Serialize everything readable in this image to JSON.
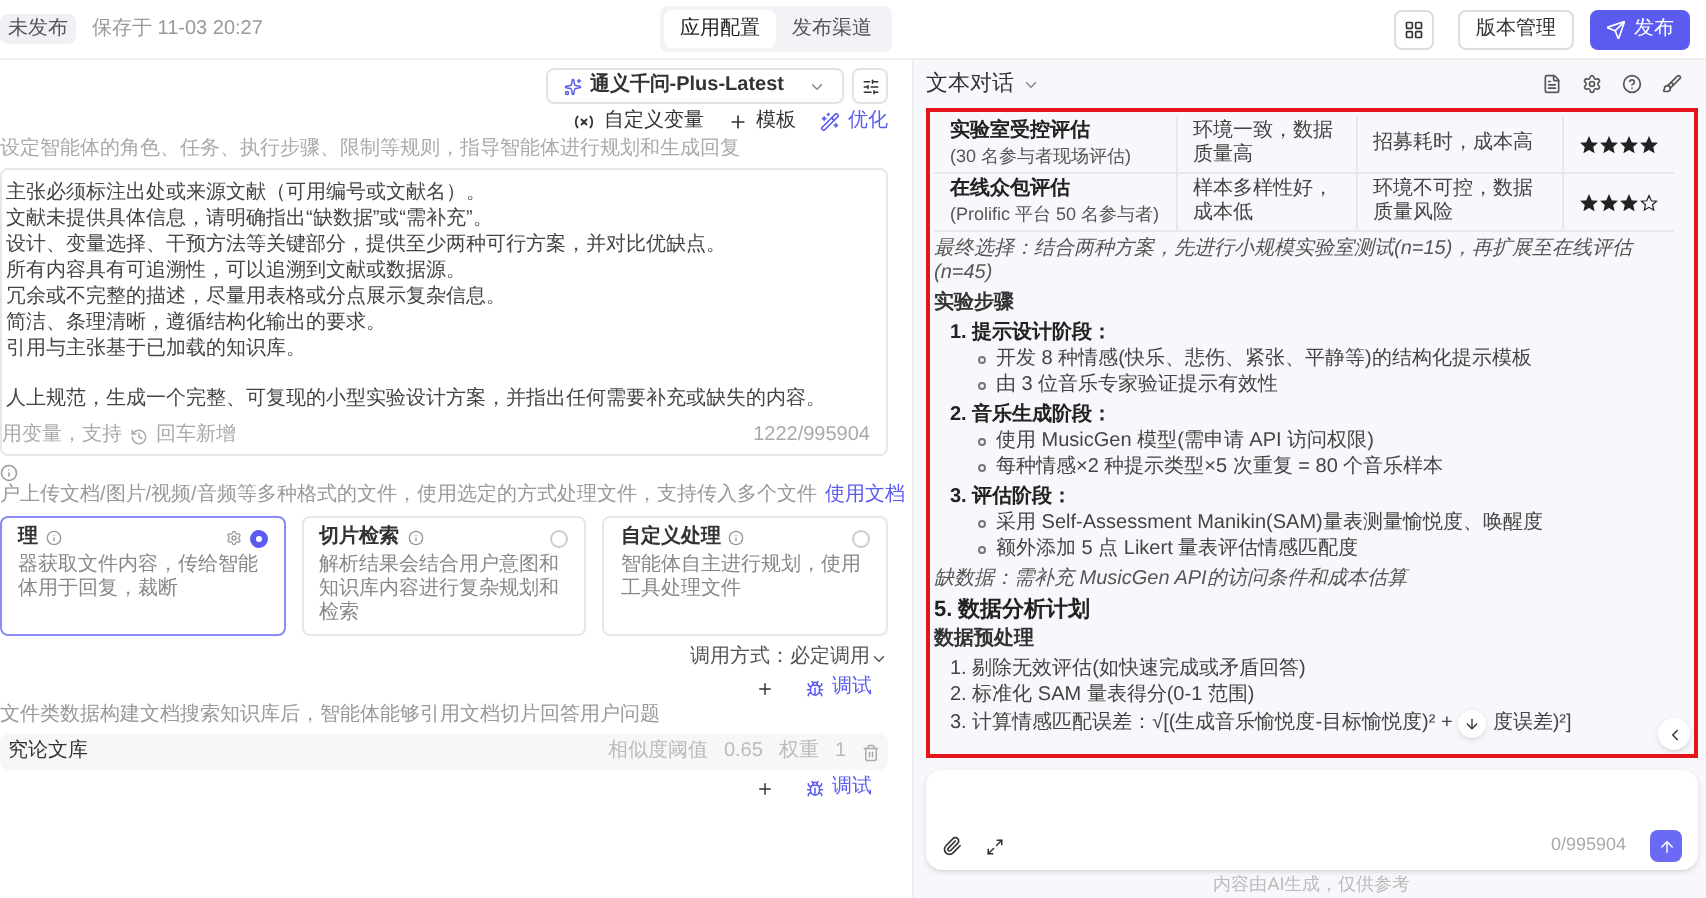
{
  "top_bar": {
    "status_badge": "未发布",
    "saved_time": "保存于 11-03 20:27",
    "tabs": [
      {
        "label": "应用配置",
        "selected": true
      },
      {
        "label": "发布渠道",
        "selected": false
      }
    ],
    "version_button": "版本管理",
    "publish_button": "发布"
  },
  "prompt": {
    "model": "通义千问-Plus-Latest",
    "tools": [
      {
        "kind": "variable",
        "label": "自定义变量"
      },
      {
        "kind": "template",
        "label": "模板"
      },
      {
        "kind": "optimize",
        "label": "优化"
      }
    ],
    "hint": "设定智能体的角色、任务、执行步骤、限制等规则，指导智能体进行规划和生成回复",
    "lines": [
      "主张必须标注出处或来源文献（可用编号或文献名）。",
      "文献未提供具体信息，请明确指出“缺数据”或“需补充”。",
      "设计、变量选择、干预方法等关键部分，提供至少两种可行方案，并对比优缺点。",
      "所有内容具有可追溯性，可以追溯到文献或数据源。",
      "冗余或不完整的描述，尽量用表格或分点展示复杂信息。",
      "简洁、条理清晰，遵循结构化输出的要求。",
      "引用与主张基于已加载的知识库。"
    ],
    "closing_line": "人上规范，生成一个完整、可复现的小型实验设计方案，并指出任何需要补充或缺失的内容。",
    "footer_left": "用变量，支持",
    "footer_hint": "回车新增",
    "counter": "1222/995904"
  },
  "files": {
    "description": "户上传文档/图片/视频/音频等多种格式的文件，使用选定的方式处理文件，支持传入多个文件",
    "link": "使用文档",
    "cards": [
      {
        "title": "理",
        "description": "器获取文件内容，传给智能体用于回复，裁断",
        "selected": true
      },
      {
        "title": "切片检索",
        "description": "解析结果会结合用户意图和知识库内容进行复杂规划和检索",
        "selected": false
      },
      {
        "title": "自定义处理",
        "description": "智能体自主进行规划，使用工具处理文件",
        "selected": false
      }
    ],
    "call_mode": "调用方式：必定调用",
    "action": "调试"
  },
  "knowledge": {
    "description": "文件类数据构建文档搜索知识库后，智能体能够引用文档切片回答用户问题",
    "items": [
      {
        "name": "究论文库",
        "threshold_label": "相似度阈值",
        "threshold": "0.65",
        "weight_label": "权重",
        "weight": "1"
      }
    ],
    "action": "调试"
  },
  "chat": {
    "mode": "文本对话",
    "table": {
      "rows": [
        {
          "name": "实验室受控评估",
          "note": "(30 名参与者现场评估)",
          "pros": "环境一致，数据质量高",
          "cons": "招募耗时，成本高",
          "stars": 4
        },
        {
          "name": "在线众包评估",
          "note": "(Prolific 平台 50 名参与者)",
          "pros": "样本多样性好，成本低",
          "cons": "环境不可控，数据质量风险",
          "stars": 3
        }
      ]
    },
    "blocks": [
      {
        "kind": "italic",
        "text": "最终选择：结合两种方案，先进行小规模实验室测试(n=15)，再扩展至在线评估(n=45)"
      },
      {
        "kind": "label",
        "text": "实验步骤"
      },
      {
        "kind": "step",
        "title": "1. 提示设计阶段：",
        "bullets": [
          "开发 8 种情感(快乐、悲伤、紧张、平静等)的结构化提示模板",
          "由 3 位音乐专家验证提示有效性"
        ]
      },
      {
        "kind": "step",
        "title": "2. 音乐生成阶段：",
        "bullets": [
          "使用 MusicGen 模型(需申请 API 访问权限)",
          "每种情感×2 种提示类型×5 次重复 = 80 个音乐样本"
        ]
      },
      {
        "kind": "step",
        "title": "3. 评估阶段：",
        "bullets": [
          "采用 Self-Assessment Manikin(SAM)量表测量愉悦度、唤醒度",
          "额外添加 5 点 Likert 量表评估情感匹配度"
        ]
      },
      {
        "kind": "italic",
        "text": "缺数据：需补充 MusicGen API的访问条件和成本估算"
      },
      {
        "kind": "heading",
        "text": "5. 数据分析计划"
      },
      {
        "kind": "label",
        "text": "数据预处理"
      },
      {
        "kind": "numbered",
        "items": [
          "1. 剔除无效评估(如快速完成或矛盾回答)",
          "2. 标准化 SAM 量表得分(0-1 范围)",
          "3. 计算情感匹配误差：√[(生成音乐愉悦度-目标愉悦度)² +"
        ],
        "covered_tail": "度误差)²]"
      }
    ],
    "input": {
      "counter": "0/995904"
    },
    "disclaimer": "内容由AI生成，仅供参考"
  }
}
